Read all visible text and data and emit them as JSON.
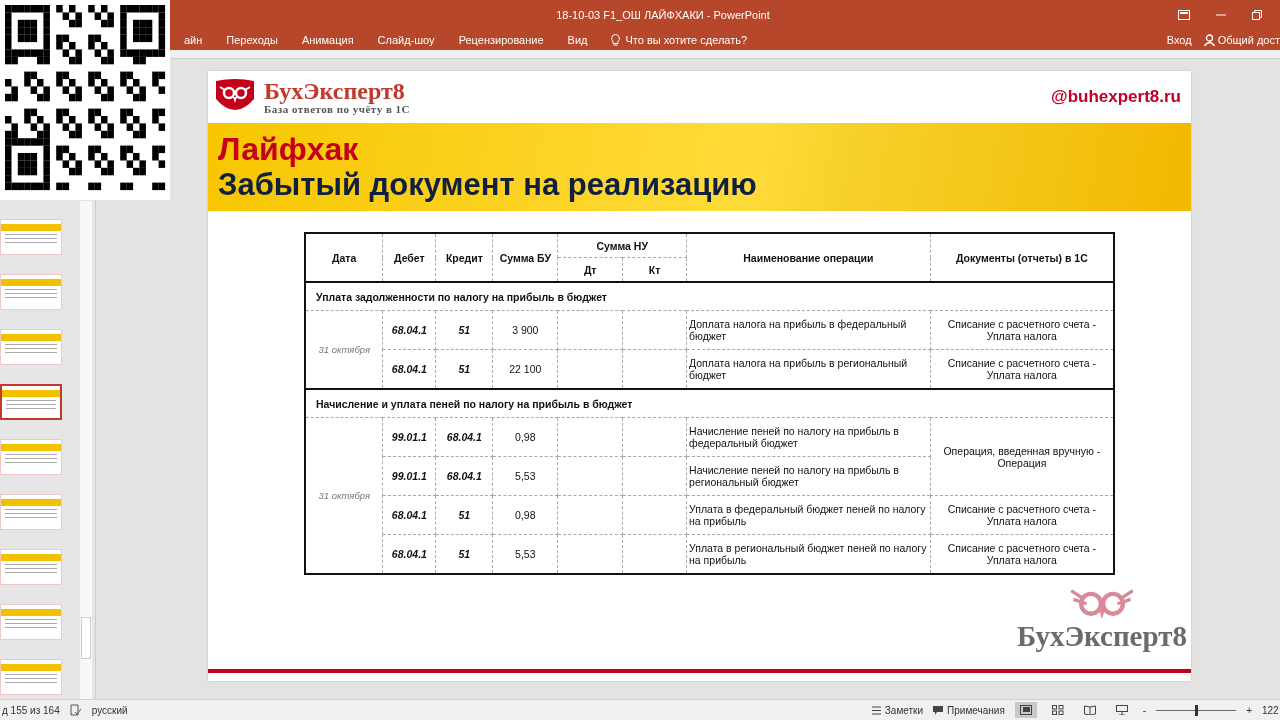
{
  "title_bar": {
    "title": "18-10-03 F1_ОШ ЛАЙФХАКИ - PowerPoint"
  },
  "ribbon_tabs": [
    {
      "label": "айн",
      "selected": false
    },
    {
      "label": "Переходы",
      "selected": false
    },
    {
      "label": "Анимация",
      "selected": false
    },
    {
      "label": "Слайд-шоу",
      "selected": false
    },
    {
      "label": "Рецензирование",
      "selected": false
    },
    {
      "label": "Вид",
      "selected": false
    }
  ],
  "tell_me": {
    "placeholder": "Что вы хотите сделать?"
  },
  "account": {
    "sign_in": "Вход",
    "share": "Общий дост"
  },
  "thumbnails": [
    {
      "selected": false
    },
    {
      "selected": false
    },
    {
      "selected": false
    },
    {
      "selected": true
    },
    {
      "selected": false
    },
    {
      "selected": false
    },
    {
      "selected": false
    },
    {
      "selected": false
    },
    {
      "selected": false
    }
  ],
  "slide": {
    "brand": "БухЭксперт8",
    "tagline": "База ответов по учёту в 1С",
    "site": "@buhexpert8.ru",
    "kicker": "Лайфхак",
    "heading": "Забытый документ на реализацию",
    "table": {
      "columns": [
        "Дата",
        "Дебет",
        "Кредит",
        "Сумма БУ",
        "Наименование операции",
        "Документы (отчеты) в 1С"
      ],
      "nu_group": "Сумма НУ",
      "nu_columns": [
        "Дт",
        "Кт"
      ],
      "sections": [
        {
          "title": "Уплата задолженности по налогу на прибыль в бюджет",
          "date": "31 октября",
          "groups": [
            {
              "document": "Списание с расчетного счета - Уплата налога",
              "rows": [
                {
                  "debit": "68.04.1",
                  "credit": "51",
                  "amount": "3 900",
                  "operation": "Доплата налога на прибыль в федеральный бюджет"
                }
              ]
            },
            {
              "document": "Списание с расчетного счета - Уплата налога",
              "rows": [
                {
                  "debit": "68.04.1",
                  "credit": "51",
                  "amount": "22 100",
                  "operation": "Доплата налога на прибыль в региональный бюджет"
                }
              ]
            }
          ]
        },
        {
          "title": "Начисление и уплата пеней по налогу на прибыль в бюджет",
          "date": "31 октября",
          "groups": [
            {
              "document": "Операция, введенная вручную - Операция",
              "rows": [
                {
                  "debit": "99.01.1",
                  "credit": "68.04.1",
                  "amount": "0,98",
                  "operation": "Начисление пеней по налогу на прибыль в федеральный бюджет"
                },
                {
                  "debit": "99.01.1",
                  "credit": "68.04.1",
                  "amount": "5,53",
                  "operation": "Начисление пеней по налогу на прибыль в региональный бюджет"
                }
              ]
            },
            {
              "document": "Списание с расчетного счета - Уплата налога",
              "rows": [
                {
                  "debit": "68.04.1",
                  "credit": "51",
                  "amount": "0,98",
                  "operation": "Уплата в федеральный бюджет пеней по налогу на прибыль"
                }
              ]
            },
            {
              "document": "Списание с расчетного счета - Уплата налога",
              "rows": [
                {
                  "debit": "68.04.1",
                  "credit": "51",
                  "amount": "5,53",
                  "operation": "Уплата в региональный бюджет пеней по налогу на прибыль"
                }
              ]
            }
          ]
        }
      ]
    },
    "footer_brand": "БухЭксперт8"
  },
  "status_bar": {
    "slide_counter": "д 155 из 164",
    "language": "русский",
    "notes": "Заметки",
    "comments": "Примечания",
    "zoom_minus": "-",
    "zoom_plus": "+",
    "zoom": "122",
    "zoom_level": {
      "level": 0.5
    }
  }
}
